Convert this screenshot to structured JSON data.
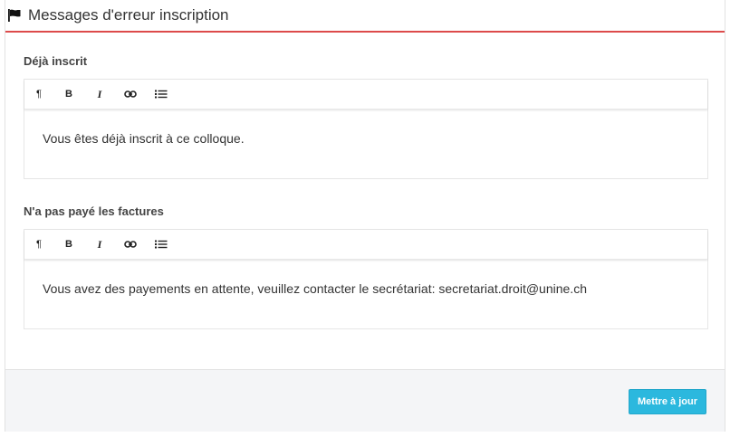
{
  "panel": {
    "title": "Messages d'erreur inscription",
    "icons": {
      "heading": "flag-icon"
    }
  },
  "toolbar": {
    "buttons": [
      {
        "glyph": "¶",
        "icon": "paragraph-icon"
      },
      {
        "glyph": "B",
        "icon": "bold-icon"
      },
      {
        "glyph": "I",
        "icon": "italic-icon"
      },
      {
        "glyph": "",
        "icon": "link-icon"
      },
      {
        "glyph": "",
        "icon": "list-icon"
      }
    ]
  },
  "fields": [
    {
      "label": "Déjà inscrit",
      "content": "Vous êtes déjà inscrit à ce colloque."
    },
    {
      "label": "N'a pas payé les factures",
      "content": "Vous avez des payements en attente, veuillez contacter le secrétariat: secretariat.droit@unine.ch"
    }
  ],
  "footer": {
    "submit_label": "Mettre à jour"
  },
  "colors": {
    "accent_border": "#dd4b4b",
    "button": "#2bb8de",
    "footer_bg": "#f4f5f7"
  }
}
